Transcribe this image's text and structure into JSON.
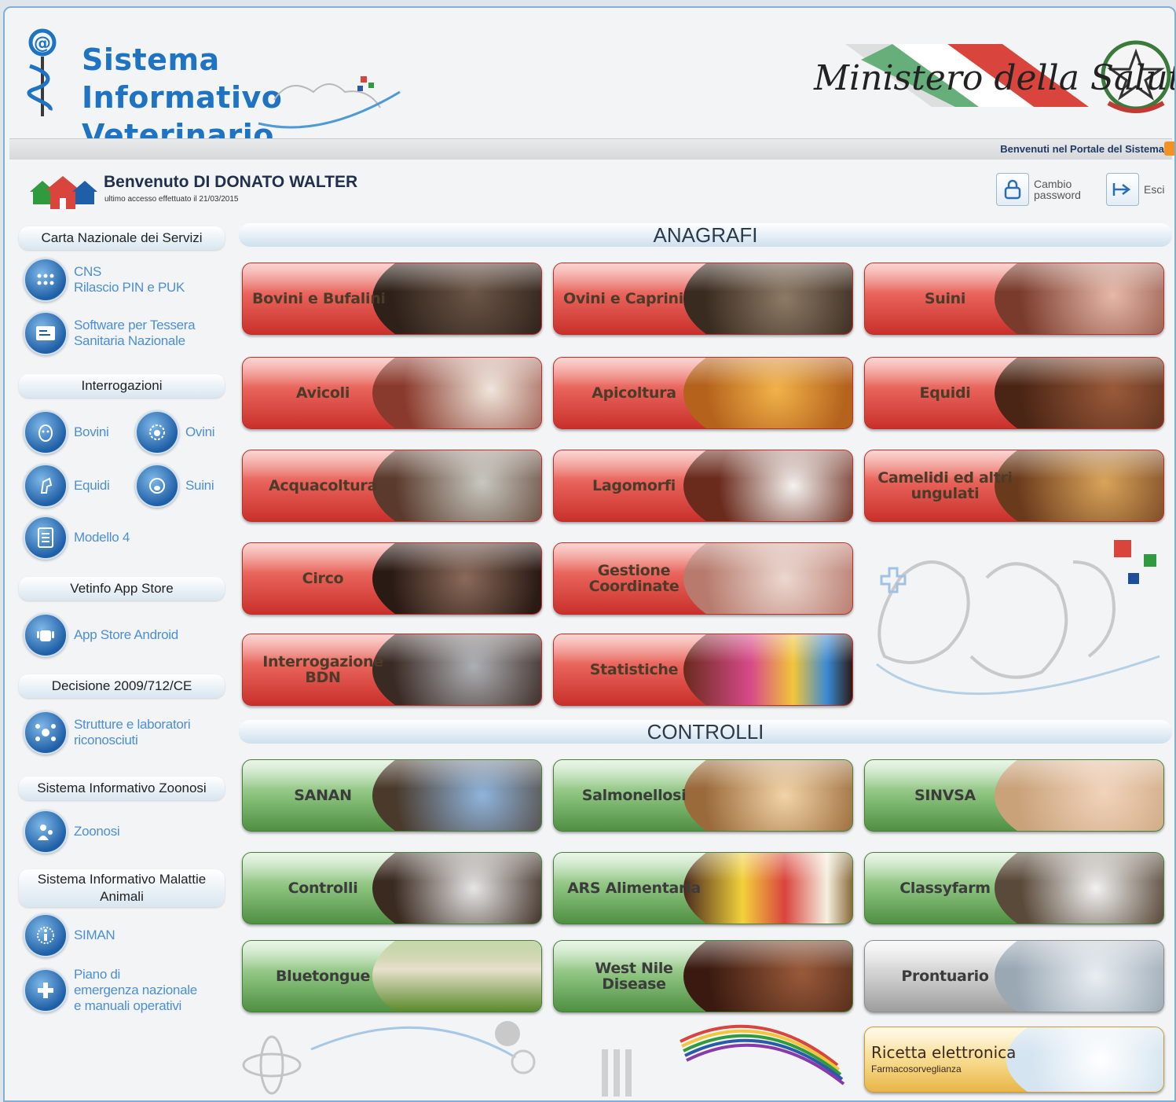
{
  "header": {
    "logo_line1": "Sistema Informativo",
    "logo_line2": "Veterinario",
    "ministry": "Ministero della Salute",
    "marquee": "Benvenuti nel Portale del Sistema"
  },
  "user": {
    "welcome": "Benvenuto DI DONATO WALTER",
    "last_access": "ultimo accesso effettuato il 21/03/2015",
    "change_password_line1": "Cambio",
    "change_password_line2": "password",
    "logout": "Esci"
  },
  "sidebar": {
    "cns": {
      "title": "Carta Nazionale dei Servizi",
      "items": [
        {
          "line1": "CNS",
          "line2": "Rilascio PIN e PUK"
        },
        {
          "line1": "Software per Tessera",
          "line2": "Sanitaria Nazionale"
        }
      ]
    },
    "interrogazioni": {
      "title": "Interrogazioni",
      "items": [
        "Bovini",
        "Ovini",
        "Equidi",
        "Suini",
        "Modello 4"
      ]
    },
    "appstore": {
      "title": "Vetinfo App Store",
      "item": "App Store Android"
    },
    "decisione": {
      "title": "Decisione 2009/712/CE",
      "item_line1": "Strutture e laboratori",
      "item_line2": "riconosciuti"
    },
    "zoonosi": {
      "title": "Sistema Informativo Zoonosi",
      "item": "Zoonosi"
    },
    "malattie": {
      "title_line1": "Sistema Informativo Malattie",
      "title_line2": "Animali",
      "items": [
        {
          "line1": "SIMAN"
        },
        {
          "line1": "Piano di",
          "line2": "emergenza nazionale",
          "line3": "e manuali operativi"
        }
      ]
    }
  },
  "anagrafi": {
    "title": "ANAGRAFI",
    "tiles": [
      "Bovini e Bufalini",
      "Ovini e Caprini",
      "Suini",
      "Avicoli",
      "Apicoltura",
      "Equidi",
      "Acquacoltura",
      "Lagomorfi",
      "Camelidi ed altri ungulati",
      "Circo",
      "Gestione Coordinate",
      "Interrogazione BDN",
      "Statistiche"
    ]
  },
  "controlli": {
    "title": "CONTROLLI",
    "tiles": [
      "SANAN",
      "Salmonellosi",
      "SINVSA",
      "Controlli",
      "ARS Alimentaria",
      "Classyfarm",
      "Bluetongue",
      "West Nile Disease",
      "Prontuario"
    ],
    "ricetta_line1": "Ricetta elettronica",
    "ricetta_line2": "Farmacosorveglianza"
  },
  "colors": {
    "brand_blue": "#1e74c2",
    "red_tile": "#d9443d",
    "green_tile": "#6aa75c",
    "link": "#4c8fd4"
  }
}
